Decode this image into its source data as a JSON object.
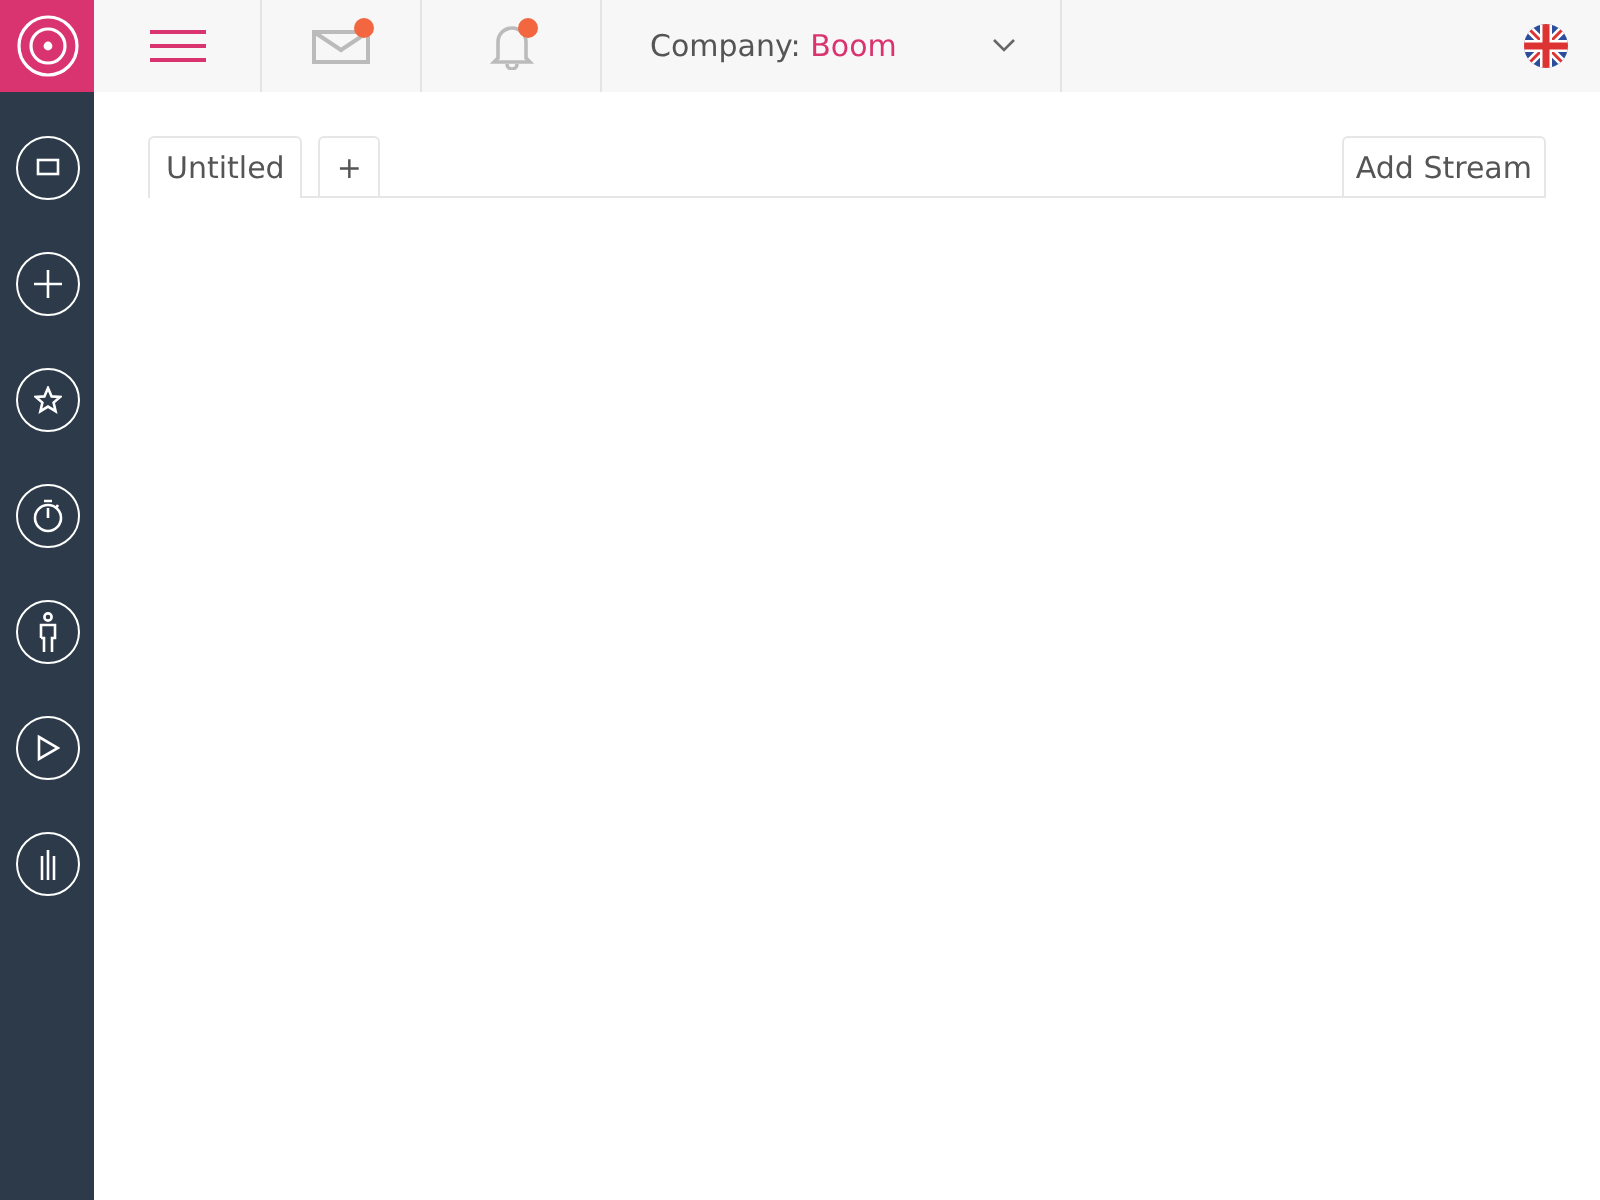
{
  "header": {
    "mail": {
      "unread": true
    },
    "notifications": {
      "unread": true
    },
    "company": {
      "label": "Company:",
      "value": "Boom"
    }
  },
  "sidebar": {
    "items": [
      {
        "kind": "screen"
      },
      {
        "kind": "plus"
      },
      {
        "kind": "star"
      },
      {
        "kind": "stopwatch"
      },
      {
        "kind": "person"
      },
      {
        "kind": "play"
      },
      {
        "kind": "bars"
      }
    ]
  },
  "tabs": [
    {
      "label": "Untitled",
      "selected": true
    },
    {
      "label": "+",
      "selected": false
    }
  ],
  "add_stream": "Add Stream"
}
